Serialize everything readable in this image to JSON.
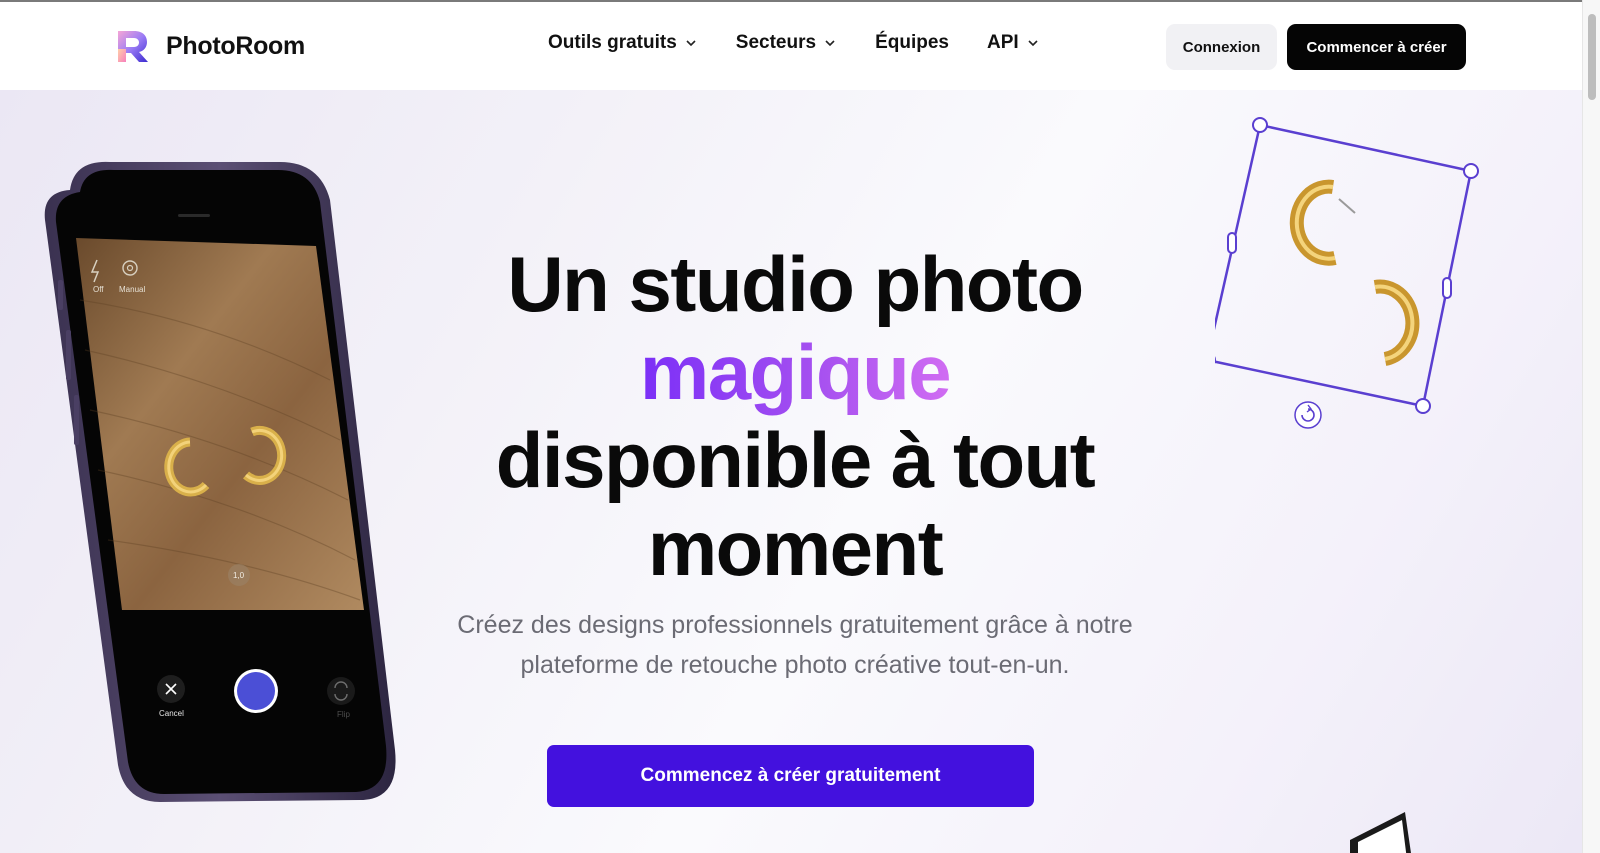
{
  "brand": {
    "name": "PhotoRoom"
  },
  "nav": {
    "items": [
      {
        "label": "Outils gratuits",
        "has_dropdown": true
      },
      {
        "label": "Secteurs",
        "has_dropdown": true
      },
      {
        "label": "Équipes",
        "has_dropdown": false
      },
      {
        "label": "API",
        "has_dropdown": true
      }
    ]
  },
  "header": {
    "login_label": "Connexion",
    "start_label": "Commencer à créer"
  },
  "hero": {
    "line1": "Un studio photo",
    "line2": "magique",
    "line3": "disponible à tout",
    "line4": "moment",
    "subtitle": "Créez des designs professionnels gratuitement grâce à notre plateforme de retouche photo créative tout-en-un.",
    "cta_label": "Commencez à créer gratuitement"
  },
  "phone_ui": {
    "flash_label": "Off",
    "mode_label": "Manual",
    "zoom_label": "1,0",
    "cancel_label": "Cancel",
    "flip_label": "Flip"
  },
  "colors": {
    "cta": "#4311de",
    "accent_gradient_start": "#7b2ff7",
    "accent_gradient_end": "#d06cf2",
    "selection_frame": "#5a3fd0",
    "shutter": "#4b4fd6"
  },
  "icons": [
    "photoroom-logo-icon",
    "chevron-down-icon",
    "flash-off-icon",
    "manual-mode-icon",
    "close-icon",
    "flip-camera-icon",
    "rotate-icon"
  ]
}
